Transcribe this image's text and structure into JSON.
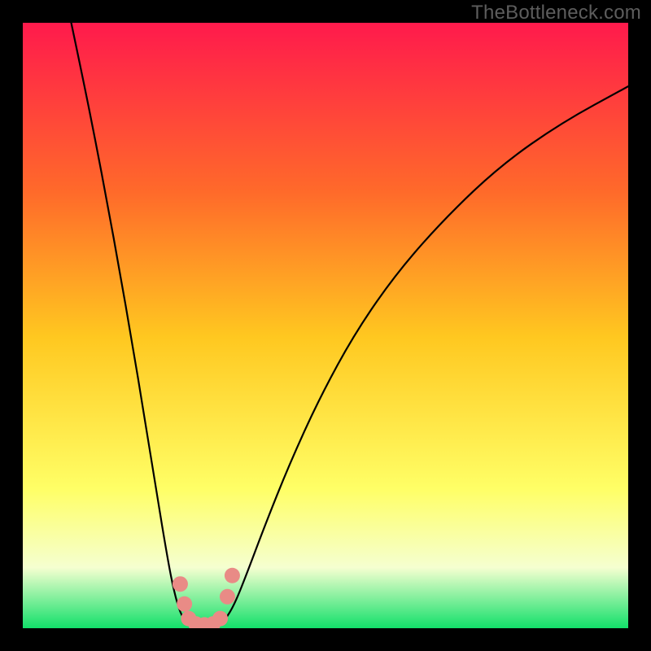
{
  "watermark": "TheBottleneck.com",
  "colors": {
    "frame_border": "#000000",
    "gradient_top": "#ff1a4c",
    "gradient_upper_mid": "#ff6a2a",
    "gradient_mid": "#ffc820",
    "gradient_lower_mid": "#ffff66",
    "gradient_low_pale": "#f5ffd0",
    "gradient_bottom": "#12e06a",
    "curve_stroke": "#000000",
    "marker_fill": "#e98b86",
    "marker_stroke": "#c46a66"
  },
  "chart_data": {
    "type": "line",
    "title": "",
    "xlabel": "",
    "ylabel": "",
    "xlim": [
      0,
      100
    ],
    "ylim": [
      0,
      100
    ],
    "grid": false,
    "legend": false,
    "series": [
      {
        "name": "left-branch",
        "x": [
          8,
          10,
          12,
          14,
          16,
          18,
          20,
          22,
          24,
          25,
          26,
          27,
          27.5
        ],
        "y": [
          100,
          90.5,
          80.5,
          70,
          59,
          47.5,
          35.5,
          23,
          11,
          6,
          2.5,
          1,
          0.5
        ]
      },
      {
        "name": "valley-floor",
        "x": [
          27.5,
          28.5,
          30,
          31.5,
          32.5
        ],
        "y": [
          0.5,
          0.2,
          0.15,
          0.2,
          0.5
        ]
      },
      {
        "name": "right-branch",
        "x": [
          32.5,
          33.5,
          35,
          37,
          40,
          44,
          49,
          55,
          62,
          70,
          79,
          89,
          100
        ],
        "y": [
          0.5,
          1.5,
          4,
          9,
          17,
          27,
          38,
          49,
          59,
          68,
          76.5,
          83.5,
          89.5
        ]
      }
    ],
    "markers": {
      "name": "datapoints",
      "shape": "circle",
      "points": [
        {
          "x": 26.0,
          "y": 7.3
        },
        {
          "x": 26.7,
          "y": 4.0
        },
        {
          "x": 27.4,
          "y": 1.6
        },
        {
          "x": 28.6,
          "y": 0.7
        },
        {
          "x": 30.0,
          "y": 0.55
        },
        {
          "x": 31.4,
          "y": 0.7
        },
        {
          "x": 32.6,
          "y": 1.6
        },
        {
          "x": 33.8,
          "y": 5.2
        },
        {
          "x": 34.6,
          "y": 8.7
        }
      ]
    }
  }
}
